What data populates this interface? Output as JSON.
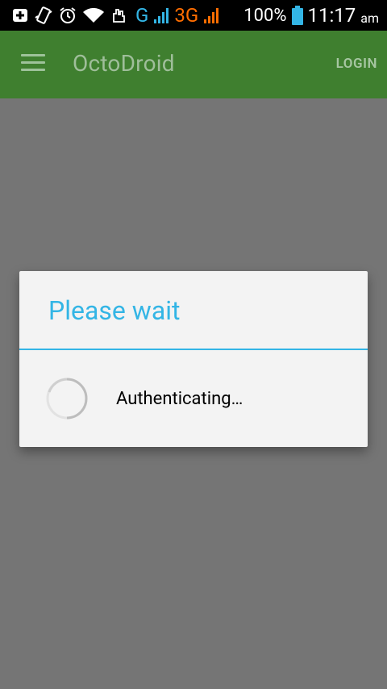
{
  "status_bar": {
    "icons": [
      "add-box-icon",
      "vibrate-icon",
      "alarm-icon",
      "wifi-icon",
      "data-hand-icon"
    ],
    "network_g": "G",
    "network_3g": "3G",
    "battery_percent": "100%",
    "time": "11:17",
    "ampm": "am"
  },
  "app_bar": {
    "title": "OctoDroid",
    "login_label": "LOGIN",
    "color": "#3f7f2f"
  },
  "dialog": {
    "title": "Please wait",
    "message": "Authenticating…",
    "accent_color": "#33b5e5"
  }
}
